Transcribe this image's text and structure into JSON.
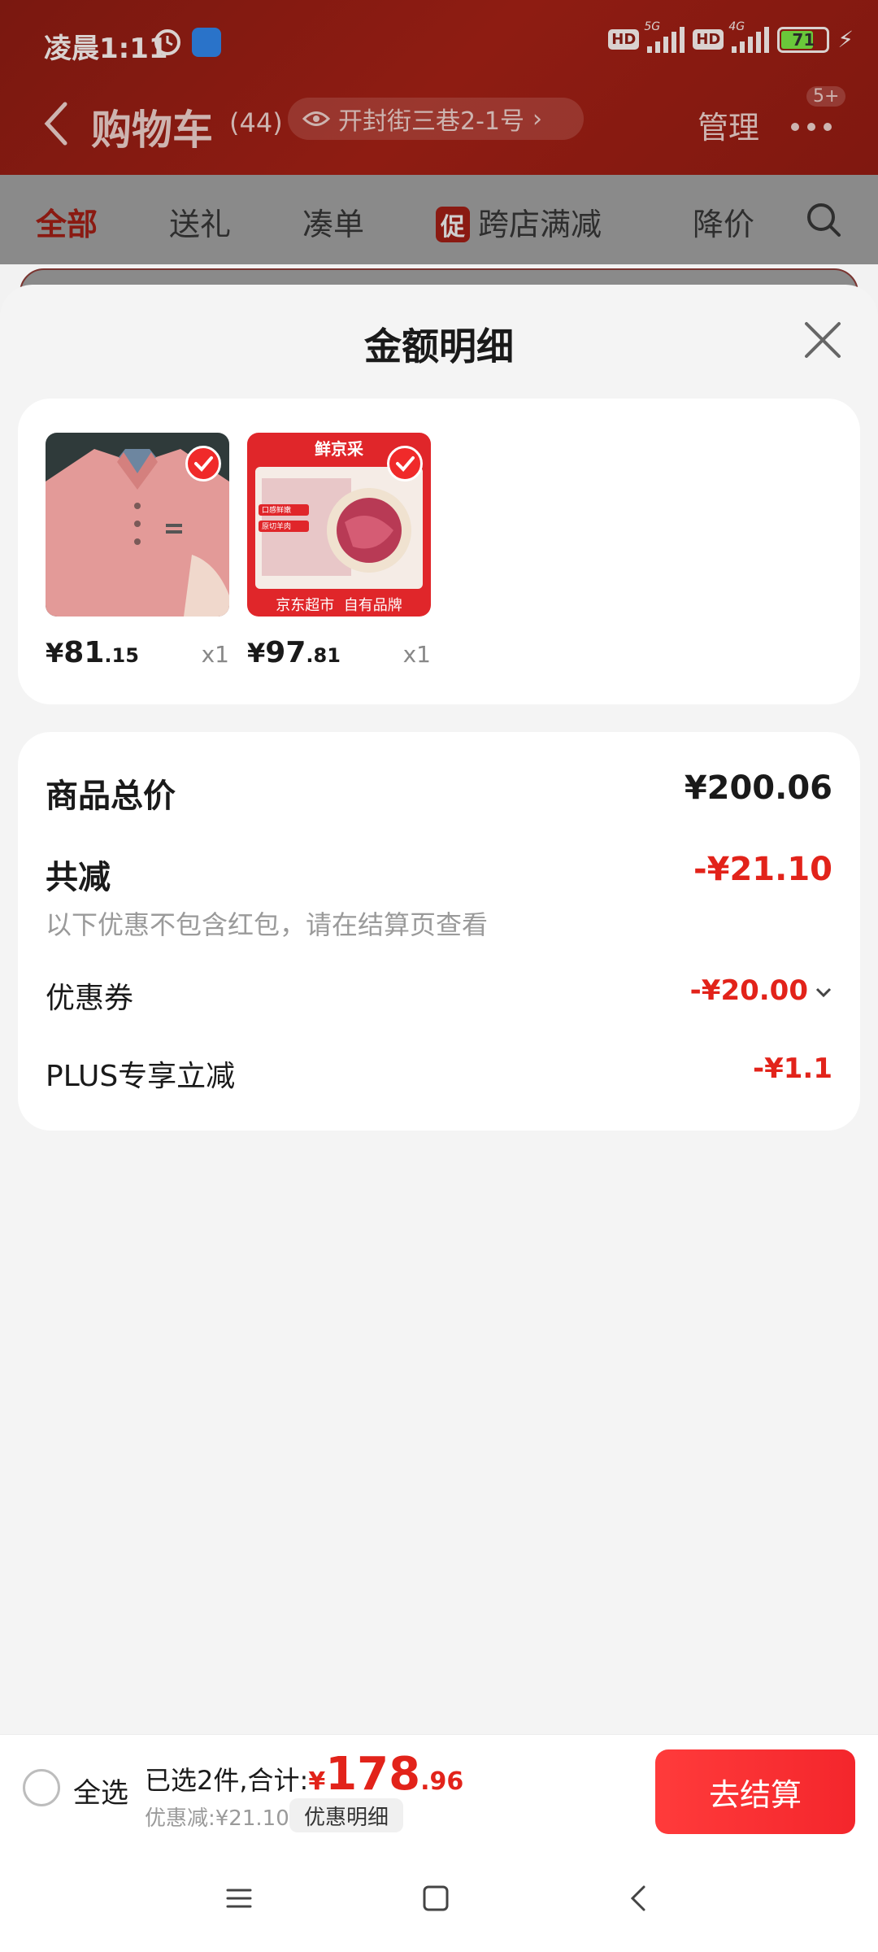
{
  "status_bar": {
    "time": "凌晨1:11",
    "network_1": "5G",
    "network_2": "4G",
    "hd_label": "HD",
    "battery": "71"
  },
  "header": {
    "title": "购物车",
    "count": "(44)",
    "address": "开封街三巷2-1号",
    "manage_label": "管理",
    "badge": "5+"
  },
  "tabs": [
    {
      "label": "全部",
      "active": true
    },
    {
      "label": "送礼"
    },
    {
      "label": "凑单"
    },
    {
      "label": "跨店满减",
      "tag": "促"
    },
    {
      "label": "降价"
    }
  ],
  "sheet": {
    "title": "金额明细",
    "products": [
      {
        "name": "pink-polo-shirt",
        "price_currency": "¥",
        "price_int": "81",
        "price_dec": ".15",
        "qty": "x1"
      },
      {
        "name": "jd-fresh-lamb",
        "price_currency": "¥",
        "price_int": "97",
        "price_dec": ".81",
        "qty": "x1",
        "image_texts": {
          "top": "鲜京采",
          "bottom": "京东超市  自有品牌",
          "tag1": "口感鲜嫩",
          "tag2": "原切羊肉"
        }
      }
    ],
    "totals": {
      "subtotal_label": "商品总价",
      "subtotal_value": "¥200.06",
      "reduction_label": "共减",
      "reduction_value": "-¥21.10",
      "note": "以下优惠不包含红包，请在结算页查看",
      "coupon_label": "优惠券",
      "coupon_value": "-¥20.00",
      "plus_label": "PLUS专享立减",
      "plus_value": "-¥1.1"
    }
  },
  "checkout": {
    "select_all_label": "全选",
    "summary_text": "已选2件,合计:",
    "total_currency": "¥",
    "total_int": "178",
    "total_dec": ".96",
    "discount_text": "优惠减:¥21.10",
    "detail_chip": "优惠明细",
    "checkout_button": "去结算"
  },
  "colors": {
    "accent_red": "#e2231a",
    "header_red": "#8e1c12",
    "checkout_gradient_start": "#ff3b3b"
  }
}
